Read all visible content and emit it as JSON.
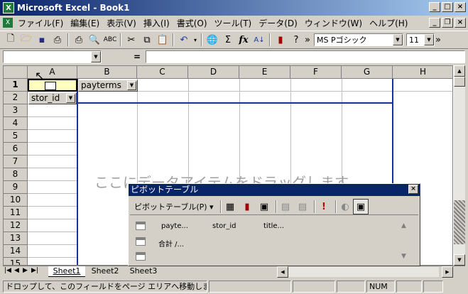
{
  "window": {
    "title": "Microsoft Excel - Book1",
    "app_icon": "X"
  },
  "menu": [
    {
      "label": "ファイル(F)"
    },
    {
      "label": "編集(E)"
    },
    {
      "label": "表示(V)"
    },
    {
      "label": "挿入(I)"
    },
    {
      "label": "書式(O)"
    },
    {
      "label": "ツール(T)"
    },
    {
      "label": "データ(D)"
    },
    {
      "label": "ウィンドウ(W)"
    },
    {
      "label": "ヘルプ(H)"
    }
  ],
  "toolbar": {
    "font_name": "MS Pゴシック",
    "font_size": "11",
    "sigma": "Σ",
    "fx": "fx"
  },
  "formula_bar": {
    "name_box": "",
    "equals": "=",
    "content": ""
  },
  "columns": [
    "A",
    "B",
    "C",
    "D",
    "E",
    "F",
    "G",
    "H"
  ],
  "rows": [
    "1",
    "2",
    "3",
    "4",
    "5",
    "6",
    "7",
    "8",
    "9",
    "10",
    "11",
    "12",
    "13",
    "14",
    "15"
  ],
  "sheet": {
    "b1_field": "payterms",
    "a2_field": "stor_id",
    "drop_hint": "ここにデータアイテムをドラッグします"
  },
  "pivot_window": {
    "title": "ピボットテーブル",
    "menu_label": "ピボットテーブル(P) ▾",
    "fields": [
      {
        "label": "payte..."
      },
      {
        "label": "stor_id"
      },
      {
        "label": "title..."
      },
      {
        "label": "合計 /..."
      }
    ]
  },
  "tabs": [
    {
      "label": "Sheet1",
      "active": true
    },
    {
      "label": "Sheet2",
      "active": false
    },
    {
      "label": "Sheet3",
      "active": false
    }
  ],
  "status": {
    "message": "ドロップして、このフィールドをページ エリアへ移動しま",
    "num": "NUM"
  }
}
